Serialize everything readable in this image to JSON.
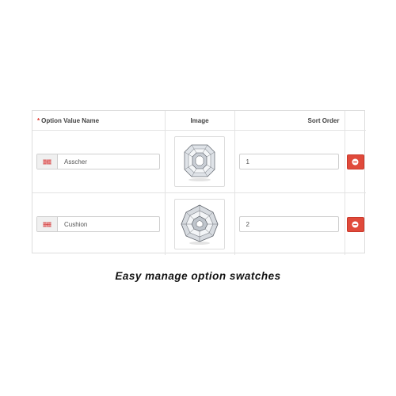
{
  "table": {
    "headers": {
      "required_mark": "*",
      "name": "Option Value Name",
      "image": "Image",
      "sort": "Sort Order"
    },
    "rows": [
      {
        "name": "Asscher",
        "image_icon": "asscher-diamond-image",
        "sort_order": "1",
        "remove_icon": "minus-circle-icon"
      },
      {
        "name": "Cushion",
        "image_icon": "cushion-diamond-image",
        "sort_order": "2",
        "remove_icon": "minus-circle-icon"
      }
    ],
    "language_flag_icon": "uk-flag-icon"
  },
  "caption": "Easy manage option swatches",
  "colors": {
    "danger": "#e04a3b",
    "required": "#e0342a",
    "border": "#dddddd"
  }
}
